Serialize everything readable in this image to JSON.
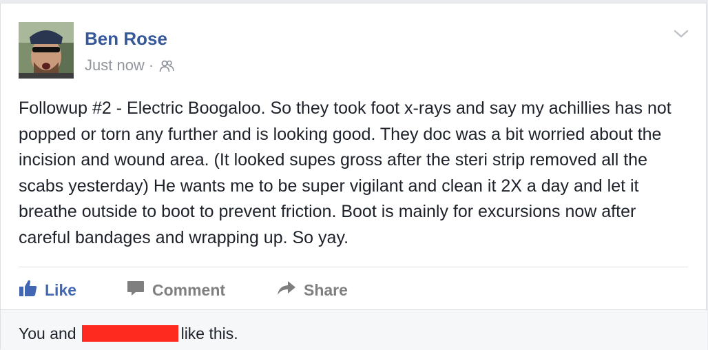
{
  "post": {
    "author": "Ben Rose",
    "timestamp": "Just now",
    "separator": "·",
    "audience_icon": "friends-icon",
    "menu_icon": "chevron-down-icon",
    "text": "Followup #2 - Electric Boogaloo. So they took foot x-rays and say my achillies has not popped or torn any further and is looking good. They doc was a bit worried about the incision and wound area. (It looked supes gross after the steri strip removed all the scabs yesterday) He wants me to be super vigilant and clean it 2X a day and let it breathe outside to boot to prevent friction. Boot is mainly for excursions now after careful bandages and wrapping up. So yay."
  },
  "actions": {
    "like_label": "Like",
    "comment_label": "Comment",
    "share_label": "Share"
  },
  "reactions": {
    "prefix": "You and",
    "suffix": "like this.",
    "redaction_color": "#ff2a1f"
  },
  "colors": {
    "link_blue": "#365899",
    "like_blue": "#4267b2",
    "muted_gray": "#90949c",
    "text": "#1d2129"
  }
}
